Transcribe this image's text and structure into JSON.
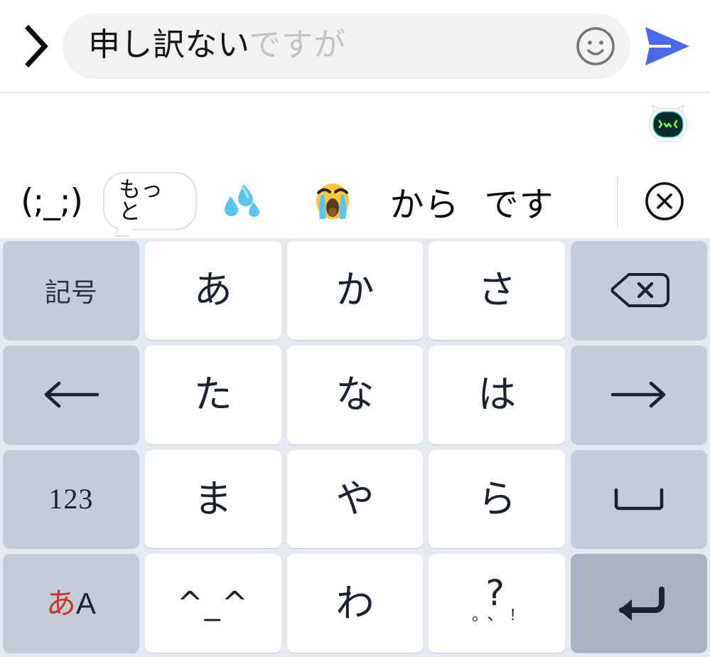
{
  "compose": {
    "expand_icon": "chevron-right-icon",
    "text_committed": "申し訳ない",
    "text_predicted": "ですが",
    "input_placeholder": "",
    "emoji_icon": "smiley-face-icon",
    "send_icon": "send-arrow-icon",
    "send_color": "#4a68ea",
    "pill_color": "#f2f2f4"
  },
  "sticker_strip": {
    "avatar_name": "cat-face-sticker",
    "avatar_face": "ʘwʘ"
  },
  "suggestions": {
    "items": [
      {
        "name": "suggestion-kaomoji",
        "type": "kaomoji",
        "label": "(;_;)"
      },
      {
        "name": "suggestion-more",
        "type": "bubble",
        "label": "もっと"
      },
      {
        "name": "suggestion-sweat-emoji",
        "type": "emoji",
        "label": "💦",
        "icon": "sweat-droplets-icon"
      },
      {
        "name": "suggestion-crying-emoji",
        "type": "emoji",
        "label": "😭",
        "icon": "loudly-crying-face-icon"
      },
      {
        "name": "suggestion-word-kara",
        "type": "word",
        "label": "から"
      },
      {
        "name": "suggestion-word-desu",
        "type": "word",
        "label": "です"
      }
    ],
    "close_icon": "circle-x-icon"
  },
  "keyboard": {
    "background": "#e6e9ef",
    "char_key_color": "#ffffff",
    "func_key_color": "#c5cbd8",
    "enter_key_color": "#aab3c2",
    "rows": [
      [
        {
          "name": "key-symbols",
          "label": "記号",
          "kind": "func",
          "glyph": "text"
        },
        {
          "name": "key-a",
          "label": "あ",
          "kind": "char",
          "glyph": "text"
        },
        {
          "name": "key-ka",
          "label": "か",
          "kind": "char",
          "glyph": "text"
        },
        {
          "name": "key-sa",
          "label": "さ",
          "kind": "char",
          "glyph": "text"
        },
        {
          "name": "key-backspace",
          "label": "⌫",
          "kind": "func",
          "glyph": "backspace-icon"
        }
      ],
      [
        {
          "name": "key-cursor-left",
          "label": "←",
          "kind": "func",
          "glyph": "arrow-left-icon"
        },
        {
          "name": "key-ta",
          "label": "た",
          "kind": "char",
          "glyph": "text"
        },
        {
          "name": "key-na",
          "label": "な",
          "kind": "char",
          "glyph": "text"
        },
        {
          "name": "key-ha",
          "label": "は",
          "kind": "char",
          "glyph": "text"
        },
        {
          "name": "key-cursor-right",
          "label": "→",
          "kind": "func",
          "glyph": "arrow-right-icon"
        }
      ],
      [
        {
          "name": "key-numbers",
          "label": "123",
          "kind": "func",
          "glyph": "num"
        },
        {
          "name": "key-ma",
          "label": "ま",
          "kind": "char",
          "glyph": "text"
        },
        {
          "name": "key-ya",
          "label": "や",
          "kind": "char",
          "glyph": "text"
        },
        {
          "name": "key-ra",
          "label": "ら",
          "kind": "char",
          "glyph": "text"
        },
        {
          "name": "key-space",
          "label": "␣",
          "kind": "func",
          "glyph": "space-icon"
        }
      ],
      [
        {
          "name": "key-input-mode",
          "label": "あA",
          "kind": "func",
          "glyph": "mode",
          "label_kana": "あ",
          "label_latin": "A",
          "kana_color": "#c0392b"
        },
        {
          "name": "key-kaomoji",
          "label": "^_^",
          "kind": "char",
          "glyph": "kaomoji"
        },
        {
          "name": "key-wa",
          "label": "わ",
          "kind": "char",
          "glyph": "text"
        },
        {
          "name": "key-punctuation",
          "label": "?",
          "kind": "char",
          "glyph": "punct",
          "label_small": "。、!"
        },
        {
          "name": "key-enter",
          "label": "↵",
          "kind": "func-enter",
          "glyph": "enter-icon"
        }
      ]
    ]
  }
}
